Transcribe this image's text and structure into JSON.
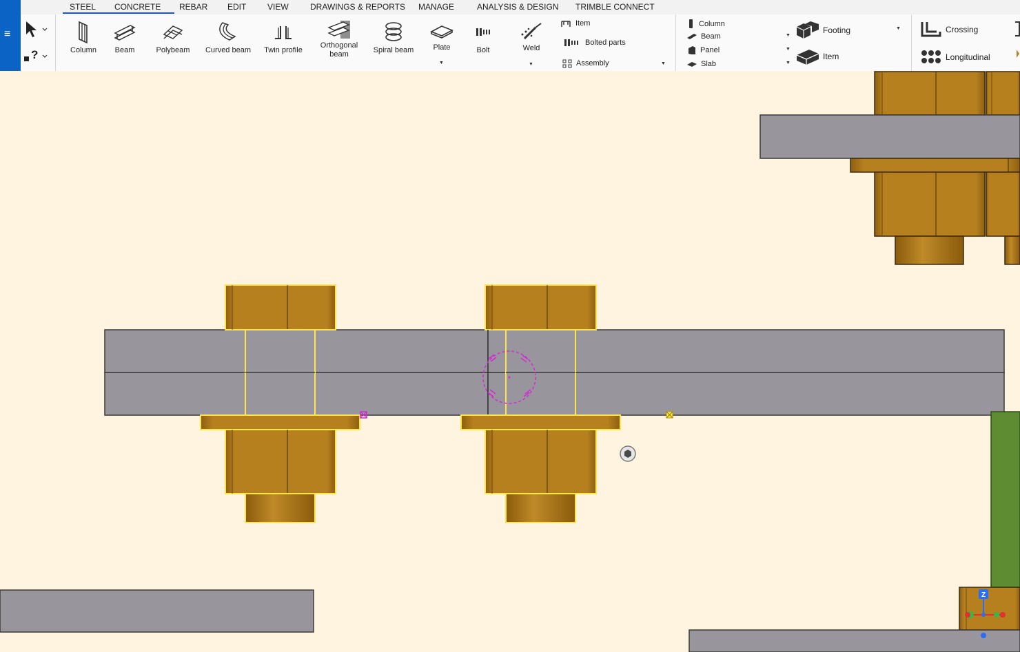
{
  "tabs": [
    "STEEL",
    "CONCRETE",
    "REBAR",
    "EDIT",
    "VIEW",
    "DRAWINGS & REPORTS",
    "MANAGE",
    "ANALYSIS & DESIGN",
    "TRIMBLE CONNECT"
  ],
  "active_tab": "STEEL",
  "steel_tools": {
    "column": "Column",
    "beam": "Beam",
    "polybeam": "Polybeam",
    "curved_beam": "Curved beam",
    "twin_profile": "Twin profile",
    "orthogonal_beam_1": "Orthogonal",
    "orthogonal_beam_2": "beam",
    "spiral_beam": "Spiral beam",
    "plate": "Plate",
    "bolt": "Bolt",
    "weld": "Weld"
  },
  "part_group": {
    "item": "Item",
    "bolted_parts": "Bolted parts",
    "assembly": "Assembly"
  },
  "concrete_group": {
    "column": "Column",
    "beam": "Beam",
    "panel": "Panel",
    "slab": "Slab",
    "footing": "Footing",
    "item": "Item"
  },
  "rebar_group": {
    "crossing": "Crossing",
    "longitudinal": "Longitudinal"
  },
  "colors": {
    "brand_blue": "#0b63c6",
    "viewport_bg": "#fff4e0",
    "steel_gray": "#98969c",
    "bolt_gold": "#b7801f",
    "selection_yellow": "#ffe44a",
    "magenta_marker": "#d628d6",
    "green_part": "#5d8c32"
  },
  "viewcube": {
    "axis_label": "Z"
  }
}
